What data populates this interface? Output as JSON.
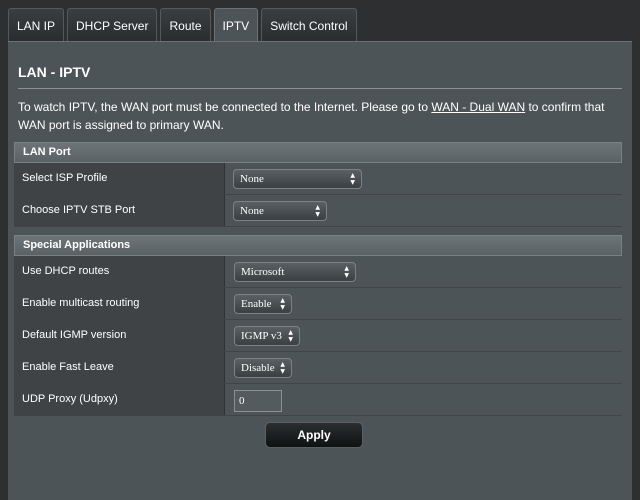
{
  "tabs": [
    {
      "label": "LAN IP"
    },
    {
      "label": "DHCP Server"
    },
    {
      "label": "Route"
    },
    {
      "label": "IPTV"
    },
    {
      "label": "Switch Control"
    }
  ],
  "active_tab": "IPTV",
  "page": {
    "title": "LAN - IPTV",
    "description_before": "To watch IPTV, the WAN port must be connected to the Internet. Please go to ",
    "description_link": "WAN - Dual WAN",
    "description_after": " to confirm that WAN port is assigned to primary WAN."
  },
  "lan_port": {
    "header": "LAN Port",
    "isp_profile": {
      "label": "Select ISP Profile",
      "value": "None"
    },
    "stb_port": {
      "label": "Choose IPTV STB Port",
      "value": "None"
    }
  },
  "special_applications": {
    "header": "Special Applications",
    "dhcp_routes": {
      "label": "Use DHCP routes",
      "value": "Microsoft"
    },
    "multicast_routing": {
      "label": "Enable multicast routing",
      "value": "Enable"
    },
    "igmp_version": {
      "label": "Default IGMP version",
      "value": "IGMP v3"
    },
    "fast_leave": {
      "label": "Enable Fast Leave",
      "value": "Disable"
    },
    "udpxy": {
      "label": "UDP Proxy (Udpxy)",
      "value": "0"
    }
  },
  "apply_label": "Apply"
}
